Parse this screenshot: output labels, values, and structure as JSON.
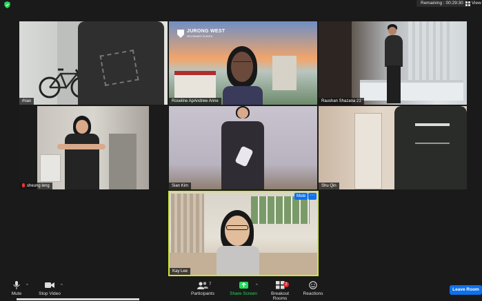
{
  "topbar": {
    "timer_text": "Remaining : 00:29:30",
    "view_label": "View"
  },
  "tiles": [
    {
      "name": "rhian"
    },
    {
      "name": "Roseline ApAndrew Anne",
      "logo_text": "JURONG WEST",
      "logo_sub": "SECONDARY SCHOOL"
    },
    {
      "name": "Raushan Shazana 21"
    },
    {
      "name": "sheung leng",
      "muted": true
    },
    {
      "name": "Sian Kim"
    },
    {
      "name": "Shu Qin"
    },
    {
      "name": "Kay Lee",
      "active": true,
      "mute_label": "Mute",
      "more_label": "···"
    }
  ],
  "toolbar": {
    "mute_label": "Mute",
    "video_label": "Stop Video",
    "participants_label": "Participants",
    "participants_count": "7",
    "share_label": "Share Screen",
    "breakout_label": "Breakout Rooms",
    "breakout_badge": "2",
    "reactions_label": "Reactions",
    "leave_label": "Leave Room"
  },
  "colors": {
    "background": "#1a1a1a",
    "active_speaker_border": "#cfe83a",
    "zoom_blue": "#0e71eb",
    "share_green": "#23d959",
    "badge_red": "#e02828"
  }
}
